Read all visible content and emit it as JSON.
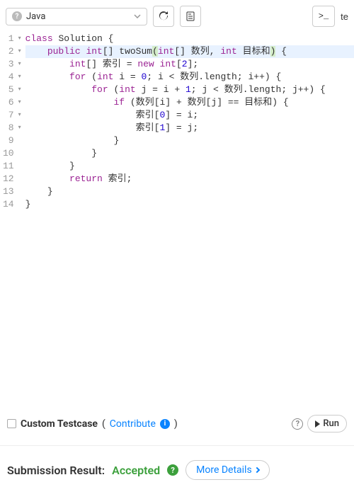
{
  "toolbar": {
    "language": "Java",
    "terminal_glyph": ">_",
    "right_text": "te"
  },
  "code": {
    "lines": [
      {
        "n": 1,
        "fold": true,
        "tokens": [
          [
            "kw",
            "class"
          ],
          [
            "sp",
            " "
          ],
          [
            "id",
            "Solution"
          ],
          [
            "sp",
            " "
          ],
          [
            "op",
            "{"
          ]
        ]
      },
      {
        "n": 2,
        "fold": true,
        "hl": true,
        "indent": 1,
        "tokens": [
          [
            "kw",
            "public"
          ],
          [
            "sp",
            " "
          ],
          [
            "type",
            "int"
          ],
          [
            "op",
            "[]"
          ],
          [
            "sp",
            " "
          ],
          [
            "fname",
            "twoSum"
          ],
          [
            "phl",
            "("
          ],
          [
            "type",
            "int"
          ],
          [
            "op",
            "[]"
          ],
          [
            "sp",
            " "
          ],
          [
            "id",
            "数列"
          ],
          [
            "op",
            ","
          ],
          [
            "sp",
            " "
          ],
          [
            "type",
            "int"
          ],
          [
            "sp",
            " "
          ],
          [
            "id",
            "目标和"
          ],
          [
            "phl",
            ")"
          ],
          [
            "sp",
            " "
          ],
          [
            "op",
            "{"
          ]
        ]
      },
      {
        "n": 3,
        "fold": true,
        "indent": 2,
        "tokens": [
          [
            "type",
            "int"
          ],
          [
            "op",
            "[]"
          ],
          [
            "sp",
            " "
          ],
          [
            "id",
            "索引"
          ],
          [
            "sp",
            " "
          ],
          [
            "op",
            "="
          ],
          [
            "sp",
            " "
          ],
          [
            "kw",
            "new"
          ],
          [
            "sp",
            " "
          ],
          [
            "type",
            "int"
          ],
          [
            "op",
            "["
          ],
          [
            "num",
            "2"
          ],
          [
            "op",
            "];"
          ]
        ]
      },
      {
        "n": 4,
        "fold": true,
        "indent": 2,
        "tokens": [
          [
            "kw",
            "for"
          ],
          [
            "sp",
            " "
          ],
          [
            "op",
            "("
          ],
          [
            "type",
            "int"
          ],
          [
            "sp",
            " "
          ],
          [
            "id",
            "i"
          ],
          [
            "sp",
            " "
          ],
          [
            "op",
            "="
          ],
          [
            "sp",
            " "
          ],
          [
            "num",
            "0"
          ],
          [
            "op",
            ";"
          ],
          [
            "sp",
            " "
          ],
          [
            "id",
            "i"
          ],
          [
            "sp",
            " "
          ],
          [
            "op",
            "<"
          ],
          [
            "sp",
            " "
          ],
          [
            "id",
            "数列"
          ],
          [
            "op",
            "."
          ],
          [
            "id",
            "length"
          ],
          [
            "op",
            ";"
          ],
          [
            "sp",
            " "
          ],
          [
            "id",
            "i"
          ],
          [
            "op",
            "++)"
          ],
          [
            "sp",
            " "
          ],
          [
            "op",
            "{"
          ]
        ]
      },
      {
        "n": 5,
        "fold": true,
        "indent": 3,
        "tokens": [
          [
            "kw",
            "for"
          ],
          [
            "sp",
            " "
          ],
          [
            "op",
            "("
          ],
          [
            "type",
            "int"
          ],
          [
            "sp",
            " "
          ],
          [
            "id",
            "j"
          ],
          [
            "sp",
            " "
          ],
          [
            "op",
            "="
          ],
          [
            "sp",
            " "
          ],
          [
            "id",
            "i"
          ],
          [
            "sp",
            " "
          ],
          [
            "op",
            "+"
          ],
          [
            "sp",
            " "
          ],
          [
            "num",
            "1"
          ],
          [
            "op",
            ";"
          ],
          [
            "sp",
            " "
          ],
          [
            "id",
            "j"
          ],
          [
            "sp",
            " "
          ],
          [
            "op",
            "<"
          ],
          [
            "sp",
            " "
          ],
          [
            "id",
            "数列"
          ],
          [
            "op",
            "."
          ],
          [
            "id",
            "length"
          ],
          [
            "op",
            ";"
          ],
          [
            "sp",
            " "
          ],
          [
            "id",
            "j"
          ],
          [
            "op",
            "++)"
          ],
          [
            "sp",
            " "
          ],
          [
            "op",
            "{"
          ]
        ]
      },
      {
        "n": 6,
        "fold": true,
        "indent": 4,
        "tokens": [
          [
            "kw",
            "if"
          ],
          [
            "sp",
            " "
          ],
          [
            "op",
            "("
          ],
          [
            "id",
            "数列"
          ],
          [
            "op",
            "["
          ],
          [
            "id",
            "i"
          ],
          [
            "op",
            "]"
          ],
          [
            "sp",
            " "
          ],
          [
            "op",
            "+"
          ],
          [
            "sp",
            " "
          ],
          [
            "id",
            "数列"
          ],
          [
            "op",
            "["
          ],
          [
            "id",
            "j"
          ],
          [
            "op",
            "]"
          ],
          [
            "sp",
            " "
          ],
          [
            "op",
            "=="
          ],
          [
            "sp",
            " "
          ],
          [
            "id",
            "目标和"
          ],
          [
            "op",
            ")"
          ],
          [
            "sp",
            " "
          ],
          [
            "op",
            "{"
          ]
        ]
      },
      {
        "n": 7,
        "fold": true,
        "indent": 5,
        "tokens": [
          [
            "id",
            "索引"
          ],
          [
            "op",
            "["
          ],
          [
            "num",
            "0"
          ],
          [
            "op",
            "]"
          ],
          [
            "sp",
            " "
          ],
          [
            "op",
            "="
          ],
          [
            "sp",
            " "
          ],
          [
            "id",
            "i"
          ],
          [
            "op",
            ";"
          ]
        ]
      },
      {
        "n": 8,
        "fold": true,
        "indent": 5,
        "tokens": [
          [
            "id",
            "索引"
          ],
          [
            "op",
            "["
          ],
          [
            "num",
            "1"
          ],
          [
            "op",
            "]"
          ],
          [
            "sp",
            " "
          ],
          [
            "op",
            "="
          ],
          [
            "sp",
            " "
          ],
          [
            "id",
            "j"
          ],
          [
            "op",
            ";"
          ]
        ]
      },
      {
        "n": 9,
        "indent": 4,
        "tokens": [
          [
            "op",
            "}"
          ]
        ]
      },
      {
        "n": 10,
        "indent": 3,
        "tokens": [
          [
            "op",
            "}"
          ]
        ]
      },
      {
        "n": 11,
        "indent": 2,
        "tokens": [
          [
            "op",
            "}"
          ]
        ]
      },
      {
        "n": 12,
        "indent": 2,
        "tokens": [
          [
            "kw",
            "return"
          ],
          [
            "sp",
            " "
          ],
          [
            "id",
            "索引"
          ],
          [
            "op",
            ";"
          ]
        ]
      },
      {
        "n": 13,
        "indent": 1,
        "tokens": [
          [
            "op",
            "}"
          ]
        ]
      },
      {
        "n": 14,
        "indent": 0,
        "tokens": [
          [
            "op",
            "}"
          ]
        ]
      }
    ]
  },
  "testcase": {
    "label": "Custom Testcase",
    "contribute": "Contribute",
    "run": "Run"
  },
  "result": {
    "label": "Submission Result:",
    "status": "Accepted",
    "details": "More Details"
  }
}
